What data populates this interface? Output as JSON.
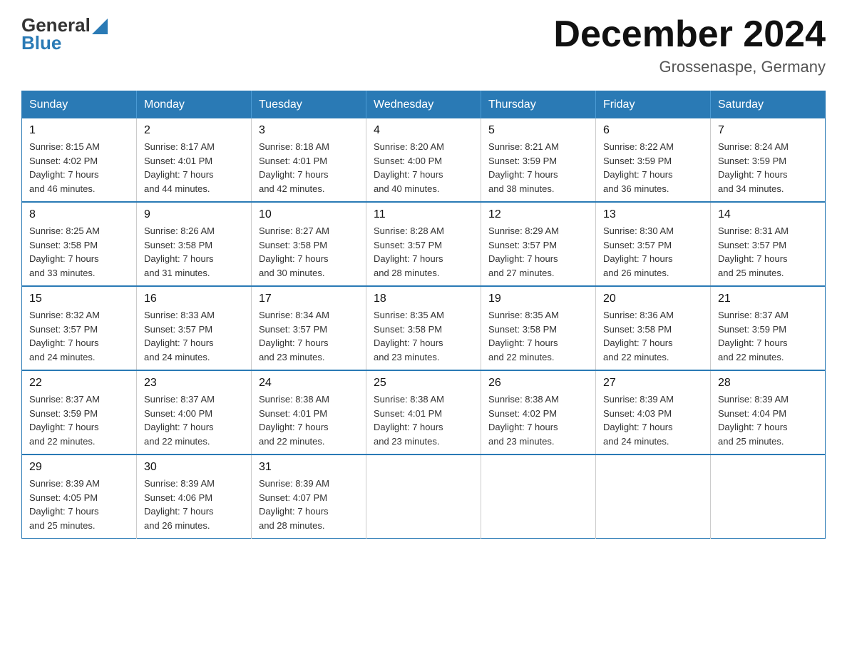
{
  "header": {
    "logo_general": "General",
    "logo_blue": "Blue",
    "title": "December 2024",
    "subtitle": "Grossenaspe, Germany"
  },
  "days_of_week": [
    "Sunday",
    "Monday",
    "Tuesday",
    "Wednesday",
    "Thursday",
    "Friday",
    "Saturday"
  ],
  "weeks": [
    [
      {
        "date": "1",
        "sunrise": "8:15 AM",
        "sunset": "4:02 PM",
        "daylight": "7 hours and 46 minutes."
      },
      {
        "date": "2",
        "sunrise": "8:17 AM",
        "sunset": "4:01 PM",
        "daylight": "7 hours and 44 minutes."
      },
      {
        "date": "3",
        "sunrise": "8:18 AM",
        "sunset": "4:01 PM",
        "daylight": "7 hours and 42 minutes."
      },
      {
        "date": "4",
        "sunrise": "8:20 AM",
        "sunset": "4:00 PM",
        "daylight": "7 hours and 40 minutes."
      },
      {
        "date": "5",
        "sunrise": "8:21 AM",
        "sunset": "3:59 PM",
        "daylight": "7 hours and 38 minutes."
      },
      {
        "date": "6",
        "sunrise": "8:22 AM",
        "sunset": "3:59 PM",
        "daylight": "7 hours and 36 minutes."
      },
      {
        "date": "7",
        "sunrise": "8:24 AM",
        "sunset": "3:59 PM",
        "daylight": "7 hours and 34 minutes."
      }
    ],
    [
      {
        "date": "8",
        "sunrise": "8:25 AM",
        "sunset": "3:58 PM",
        "daylight": "7 hours and 33 minutes."
      },
      {
        "date": "9",
        "sunrise": "8:26 AM",
        "sunset": "3:58 PM",
        "daylight": "7 hours and 31 minutes."
      },
      {
        "date": "10",
        "sunrise": "8:27 AM",
        "sunset": "3:58 PM",
        "daylight": "7 hours and 30 minutes."
      },
      {
        "date": "11",
        "sunrise": "8:28 AM",
        "sunset": "3:57 PM",
        "daylight": "7 hours and 28 minutes."
      },
      {
        "date": "12",
        "sunrise": "8:29 AM",
        "sunset": "3:57 PM",
        "daylight": "7 hours and 27 minutes."
      },
      {
        "date": "13",
        "sunrise": "8:30 AM",
        "sunset": "3:57 PM",
        "daylight": "7 hours and 26 minutes."
      },
      {
        "date": "14",
        "sunrise": "8:31 AM",
        "sunset": "3:57 PM",
        "daylight": "7 hours and 25 minutes."
      }
    ],
    [
      {
        "date": "15",
        "sunrise": "8:32 AM",
        "sunset": "3:57 PM",
        "daylight": "7 hours and 24 minutes."
      },
      {
        "date": "16",
        "sunrise": "8:33 AM",
        "sunset": "3:57 PM",
        "daylight": "7 hours and 24 minutes."
      },
      {
        "date": "17",
        "sunrise": "8:34 AM",
        "sunset": "3:57 PM",
        "daylight": "7 hours and 23 minutes."
      },
      {
        "date": "18",
        "sunrise": "8:35 AM",
        "sunset": "3:58 PM",
        "daylight": "7 hours and 23 minutes."
      },
      {
        "date": "19",
        "sunrise": "8:35 AM",
        "sunset": "3:58 PM",
        "daylight": "7 hours and 22 minutes."
      },
      {
        "date": "20",
        "sunrise": "8:36 AM",
        "sunset": "3:58 PM",
        "daylight": "7 hours and 22 minutes."
      },
      {
        "date": "21",
        "sunrise": "8:37 AM",
        "sunset": "3:59 PM",
        "daylight": "7 hours and 22 minutes."
      }
    ],
    [
      {
        "date": "22",
        "sunrise": "8:37 AM",
        "sunset": "3:59 PM",
        "daylight": "7 hours and 22 minutes."
      },
      {
        "date": "23",
        "sunrise": "8:37 AM",
        "sunset": "4:00 PM",
        "daylight": "7 hours and 22 minutes."
      },
      {
        "date": "24",
        "sunrise": "8:38 AM",
        "sunset": "4:01 PM",
        "daylight": "7 hours and 22 minutes."
      },
      {
        "date": "25",
        "sunrise": "8:38 AM",
        "sunset": "4:01 PM",
        "daylight": "7 hours and 23 minutes."
      },
      {
        "date": "26",
        "sunrise": "8:38 AM",
        "sunset": "4:02 PM",
        "daylight": "7 hours and 23 minutes."
      },
      {
        "date": "27",
        "sunrise": "8:39 AM",
        "sunset": "4:03 PM",
        "daylight": "7 hours and 24 minutes."
      },
      {
        "date": "28",
        "sunrise": "8:39 AM",
        "sunset": "4:04 PM",
        "daylight": "7 hours and 25 minutes."
      }
    ],
    [
      {
        "date": "29",
        "sunrise": "8:39 AM",
        "sunset": "4:05 PM",
        "daylight": "7 hours and 25 minutes."
      },
      {
        "date": "30",
        "sunrise": "8:39 AM",
        "sunset": "4:06 PM",
        "daylight": "7 hours and 26 minutes."
      },
      {
        "date": "31",
        "sunrise": "8:39 AM",
        "sunset": "4:07 PM",
        "daylight": "7 hours and 28 minutes."
      },
      null,
      null,
      null,
      null
    ]
  ],
  "labels": {
    "sunrise": "Sunrise:",
    "sunset": "Sunset:",
    "daylight": "Daylight:"
  },
  "colors": {
    "header_bg": "#2a7ab5",
    "header_text": "#ffffff",
    "border": "#2a7ab5"
  }
}
